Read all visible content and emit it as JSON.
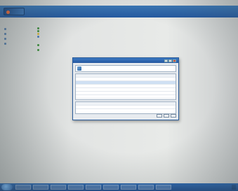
{
  "browser": {
    "links": [
      "",
      ""
    ]
  },
  "sidebar": {
    "items": [
      {
        "label": ""
      },
      {
        "label": ""
      },
      {
        "label": ""
      },
      {
        "label": ""
      }
    ]
  },
  "main": {
    "title": "",
    "sections": [
      {
        "head": "",
        "lines": [
          "",
          "",
          "",
          "",
          ""
        ]
      },
      {
        "head": "",
        "lines": [
          "",
          ""
        ]
      },
      {
        "head": "",
        "lines": [
          "",
          ""
        ]
      }
    ]
  },
  "dialog": {
    "title": "",
    "heading": "",
    "grid_header": [
      "",
      "",
      "",
      "",
      ""
    ],
    "grid_rows": [
      [
        "",
        "",
        "",
        "",
        ""
      ],
      [
        "",
        "",
        "",
        "",
        ""
      ],
      [
        "",
        "",
        "",
        "",
        ""
      ],
      [
        "",
        "",
        "",
        "",
        ""
      ],
      [
        "",
        "",
        "",
        "",
        ""
      ],
      [
        "",
        "",
        "",
        "",
        ""
      ]
    ],
    "list_header": [
      "",
      "",
      "",
      "",
      ""
    ],
    "list_rows": [
      [
        "",
        "",
        "",
        "",
        ""
      ]
    ],
    "buttons": [
      "",
      "",
      ""
    ]
  },
  "taskbar": {
    "items": [
      "",
      "",
      "",
      "",
      "",
      "",
      "",
      "",
      ""
    ],
    "clock": ""
  }
}
